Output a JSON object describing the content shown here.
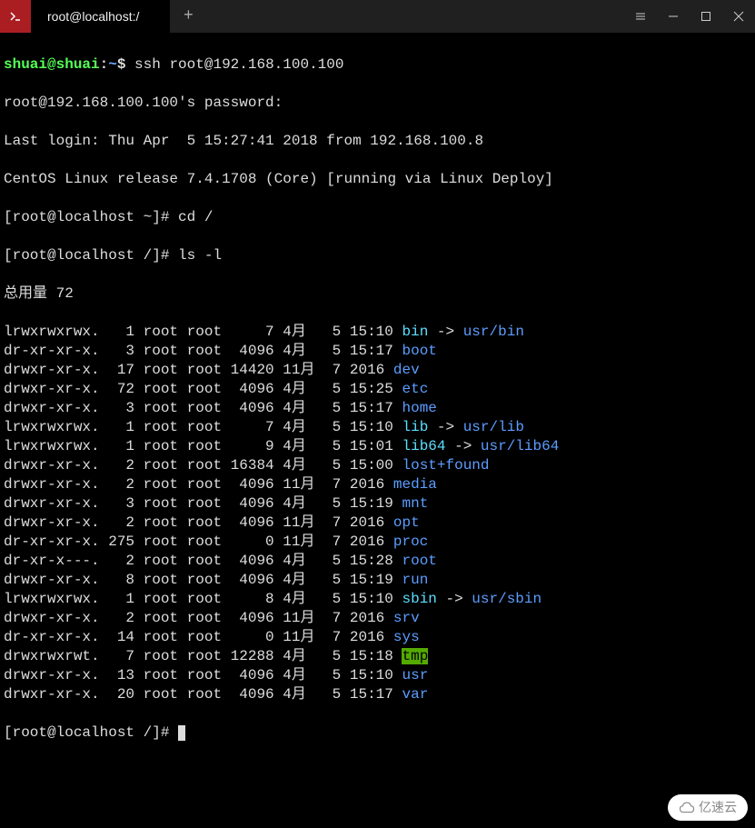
{
  "titlebar": {
    "tab_title": "root@localhost:/"
  },
  "session": {
    "l1_user": "shuai@shuai",
    "l1_sep": ":",
    "l1_path": "~",
    "l1_dollar": "$ ",
    "l1_cmd": "ssh root@192.168.100.100",
    "l2": "root@192.168.100.100's password:",
    "l3": "Last login: Thu Apr  5 15:27:41 2018 from 192.168.100.8",
    "l4": "CentOS Linux release 7.4.1708 (Core) [running via Linux Deploy]",
    "l5": "[root@localhost ~]# cd /",
    "l6": "[root@localhost /]# ls -l",
    "total": "总用量 72",
    "final_prompt": "[root@localhost /]# "
  },
  "files": [
    {
      "pre": "lrwxrwxrwx.   1 root root     7 4月   5 15:10 ",
      "name": "bin",
      "cls": "link",
      "post": " -> ",
      "target": "usr/bin",
      "tcls": "linktarget-dir"
    },
    {
      "pre": "dr-xr-xr-x.   3 root root  4096 4月   5 15:17 ",
      "name": "boot",
      "cls": "dir"
    },
    {
      "pre": "drwxr-xr-x.  17 root root 14420 11月  7 2016 ",
      "name": "dev",
      "cls": "dir"
    },
    {
      "pre": "drwxr-xr-x.  72 root root  4096 4月   5 15:25 ",
      "name": "etc",
      "cls": "dir"
    },
    {
      "pre": "drwxr-xr-x.   3 root root  4096 4月   5 15:17 ",
      "name": "home",
      "cls": "dir"
    },
    {
      "pre": "lrwxrwxrwx.   1 root root     7 4月   5 15:10 ",
      "name": "lib",
      "cls": "link",
      "post": " -> ",
      "target": "usr/lib",
      "tcls": "linktarget-dir"
    },
    {
      "pre": "lrwxrwxrwx.   1 root root     9 4月   5 15:01 ",
      "name": "lib64",
      "cls": "link",
      "post": " -> ",
      "target": "usr/lib64",
      "tcls": "linktarget-dir"
    },
    {
      "pre": "drwxr-xr-x.   2 root root 16384 4月   5 15:00 ",
      "name": "lost+found",
      "cls": "dir"
    },
    {
      "pre": "drwxr-xr-x.   2 root root  4096 11月  7 2016 ",
      "name": "media",
      "cls": "dir"
    },
    {
      "pre": "drwxr-xr-x.   3 root root  4096 4月   5 15:19 ",
      "name": "mnt",
      "cls": "dir"
    },
    {
      "pre": "drwxr-xr-x.   2 root root  4096 11月  7 2016 ",
      "name": "opt",
      "cls": "dir"
    },
    {
      "pre": "dr-xr-xr-x. 275 root root     0 11月  7 2016 ",
      "name": "proc",
      "cls": "dir"
    },
    {
      "pre": "dr-xr-x---.   2 root root  4096 4月   5 15:28 ",
      "name": "root",
      "cls": "dir"
    },
    {
      "pre": "drwxr-xr-x.   8 root root  4096 4月   5 15:19 ",
      "name": "run",
      "cls": "dir"
    },
    {
      "pre": "lrwxrwxrwx.   1 root root     8 4月   5 15:10 ",
      "name": "sbin",
      "cls": "link",
      "post": " -> ",
      "target": "usr/sbin",
      "tcls": "linktarget-dir"
    },
    {
      "pre": "drwxr-xr-x.   2 root root  4096 11月  7 2016 ",
      "name": "srv",
      "cls": "dir"
    },
    {
      "pre": "dr-xr-xr-x.  14 root root     0 11月  7 2016 ",
      "name": "sys",
      "cls": "dir"
    },
    {
      "pre": "drwxrwxrwt.   7 root root 12288 4月   5 15:18 ",
      "name": "tmp",
      "cls": "tmp"
    },
    {
      "pre": "drwxr-xr-x.  13 root root  4096 4月   5 15:10 ",
      "name": "usr",
      "cls": "dir"
    },
    {
      "pre": "drwxr-xr-x.  20 root root  4096 4月   5 15:17 ",
      "name": "var",
      "cls": "dir"
    }
  ],
  "watermark": "亿速云"
}
